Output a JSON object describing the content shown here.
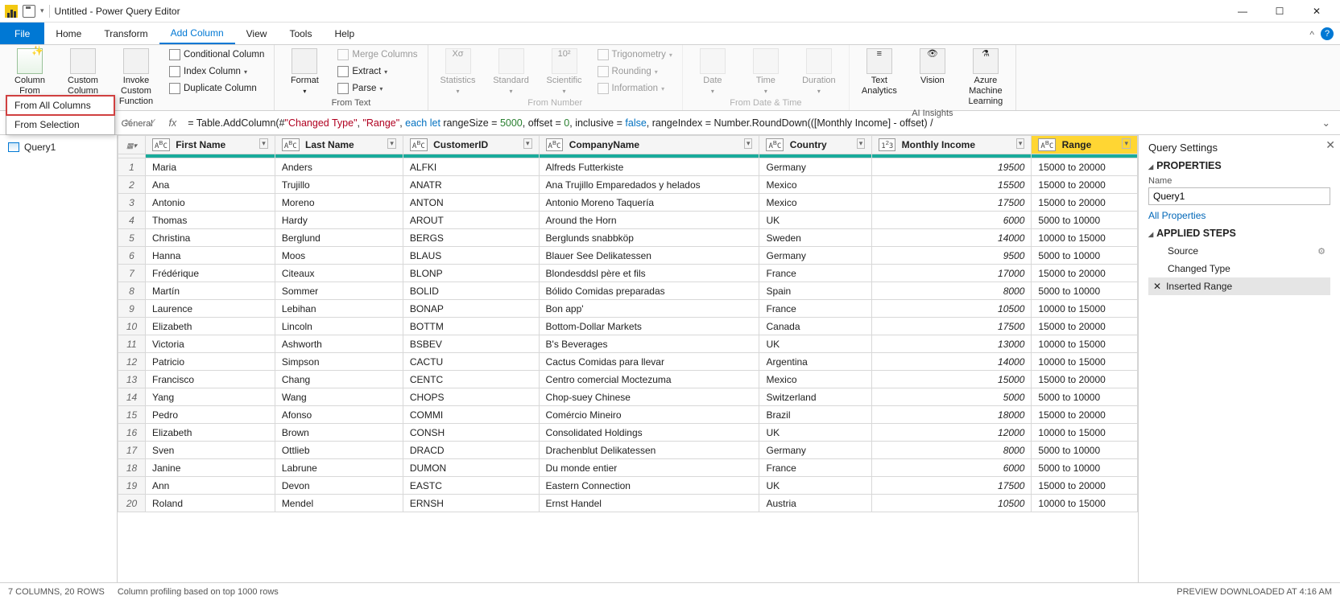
{
  "title": "Untitled - Power Query Editor",
  "ribbon_tabs": [
    "File",
    "Home",
    "Transform",
    "Add Column",
    "View",
    "Tools",
    "Help"
  ],
  "active_tab": "Add Column",
  "ribbon": {
    "general": {
      "column_from_examples": "Column From Examples",
      "custom_column": "Custom Column",
      "invoke_custom_function": "Invoke Custom Function",
      "conditional_column": "Conditional Column",
      "index_column": "Index Column",
      "duplicate_column": "Duplicate Column",
      "label": "General"
    },
    "from_text": {
      "format": "Format",
      "merge_columns": "Merge Columns",
      "extract": "Extract",
      "parse": "Parse",
      "label": "From Text"
    },
    "from_number": {
      "statistics": "Statistics",
      "standard": "Standard",
      "scientific": "Scientific",
      "trigonometry": "Trigonometry",
      "rounding": "Rounding",
      "information": "Information",
      "label": "From Number"
    },
    "from_datetime": {
      "date": "Date",
      "time": "Time",
      "duration": "Duration",
      "label": "From Date & Time"
    },
    "ai": {
      "text_analytics": "Text Analytics",
      "vision": "Vision",
      "aml": "Azure Machine Learning",
      "label": "AI Insights"
    }
  },
  "dropdown": {
    "from_all": "From All Columns",
    "from_selection": "From Selection"
  },
  "formula_prefix": "= Table.AddColumn(#",
  "formula_str1": "\"Changed Type\"",
  "formula_str2": "\"Range\"",
  "formula_mid1": ", ",
  "formula_mid2": ", ",
  "formula_kw1": "each let",
  "formula_seg1": " rangeSize = ",
  "formula_num1": "5000",
  "formula_seg2": ", offset = ",
  "formula_num2": "0",
  "formula_seg3": ", inclusive = ",
  "formula_kw2": "false",
  "formula_seg4": ", rangeIndex = Number.RoundDown(([Monthly Income] - offset) /",
  "queries_panel": {
    "query1": "Query1"
  },
  "columns": [
    {
      "name": "First Name",
      "type": "ABC"
    },
    {
      "name": "Last Name",
      "type": "ABC"
    },
    {
      "name": "CustomerID",
      "type": "ABC"
    },
    {
      "name": "CompanyName",
      "type": "ABC"
    },
    {
      "name": "Country",
      "type": "ABC"
    },
    {
      "name": "Monthly Income",
      "type": "123"
    },
    {
      "name": "Range",
      "type": "ABC",
      "highlight": true
    }
  ],
  "rows": [
    [
      "Maria",
      "Anders",
      "ALFKI",
      "Alfreds Futterkiste",
      "Germany",
      "19500",
      "15000 to 20000"
    ],
    [
      "Ana",
      "Trujillo",
      "ANATR",
      "Ana Trujillo Emparedados y helados",
      "Mexico",
      "15500",
      "15000 to 20000"
    ],
    [
      "Antonio",
      "Moreno",
      "ANTON",
      "Antonio Moreno Taquería",
      "Mexico",
      "17500",
      "15000 to 20000"
    ],
    [
      "Thomas",
      "Hardy",
      "AROUT",
      "Around the Horn",
      "UK",
      "6000",
      "5000 to 10000"
    ],
    [
      "Christina",
      "Berglund",
      "BERGS",
      "Berglunds snabbköp",
      "Sweden",
      "14000",
      "10000 to 15000"
    ],
    [
      "Hanna",
      "Moos",
      "BLAUS",
      "Blauer See Delikatessen",
      "Germany",
      "9500",
      "5000 to 10000"
    ],
    [
      "Frédérique",
      "Citeaux",
      "BLONP",
      "Blondesddsl père et fils",
      "France",
      "17000",
      "15000 to 20000"
    ],
    [
      "Martín",
      "Sommer",
      "BOLID",
      "Bólido Comidas preparadas",
      "Spain",
      "8000",
      "5000 to 10000"
    ],
    [
      "Laurence",
      "Lebihan",
      "BONAP",
      "Bon app'",
      "France",
      "10500",
      "10000 to 15000"
    ],
    [
      "Elizabeth",
      "Lincoln",
      "BOTTM",
      "Bottom-Dollar Markets",
      "Canada",
      "17500",
      "15000 to 20000"
    ],
    [
      "Victoria",
      "Ashworth",
      "BSBEV",
      "B's Beverages",
      "UK",
      "13000",
      "10000 to 15000"
    ],
    [
      "Patricio",
      "Simpson",
      "CACTU",
      "Cactus Comidas para llevar",
      "Argentina",
      "14000",
      "10000 to 15000"
    ],
    [
      "Francisco",
      "Chang",
      "CENTC",
      "Centro comercial Moctezuma",
      "Mexico",
      "15000",
      "15000 to 20000"
    ],
    [
      "Yang",
      "Wang",
      "CHOPS",
      "Chop-suey Chinese",
      "Switzerland",
      "5000",
      "5000 to 10000"
    ],
    [
      "Pedro",
      "Afonso",
      "COMMI",
      "Comércio Mineiro",
      "Brazil",
      "18000",
      "15000 to 20000"
    ],
    [
      "Elizabeth",
      "Brown",
      "CONSH",
      "Consolidated Holdings",
      "UK",
      "12000",
      "10000 to 15000"
    ],
    [
      "Sven",
      "Ottlieb",
      "DRACD",
      "Drachenblut Delikatessen",
      "Germany",
      "8000",
      "5000 to 10000"
    ],
    [
      "Janine",
      "Labrune",
      "DUMON",
      "Du monde entier",
      "France",
      "6000",
      "5000 to 10000"
    ],
    [
      "Ann",
      "Devon",
      "EASTC",
      "Eastern Connection",
      "UK",
      "17500",
      "15000 to 20000"
    ],
    [
      "Roland",
      "Mendel",
      "ERNSH",
      "Ernst Handel",
      "Austria",
      "10500",
      "10000 to 15000"
    ]
  ],
  "settings": {
    "title": "Query Settings",
    "properties": "PROPERTIES",
    "name_label": "Name",
    "name_value": "Query1",
    "all_properties": "All Properties",
    "applied_steps": "APPLIED STEPS",
    "steps": [
      "Source",
      "Changed Type",
      "Inserted Range"
    ],
    "selected_step": 2
  },
  "status": {
    "left1": "7 COLUMNS, 20 ROWS",
    "left2": "Column profiling based on top 1000 rows",
    "right": "PREVIEW DOWNLOADED AT 4:16 AM"
  }
}
